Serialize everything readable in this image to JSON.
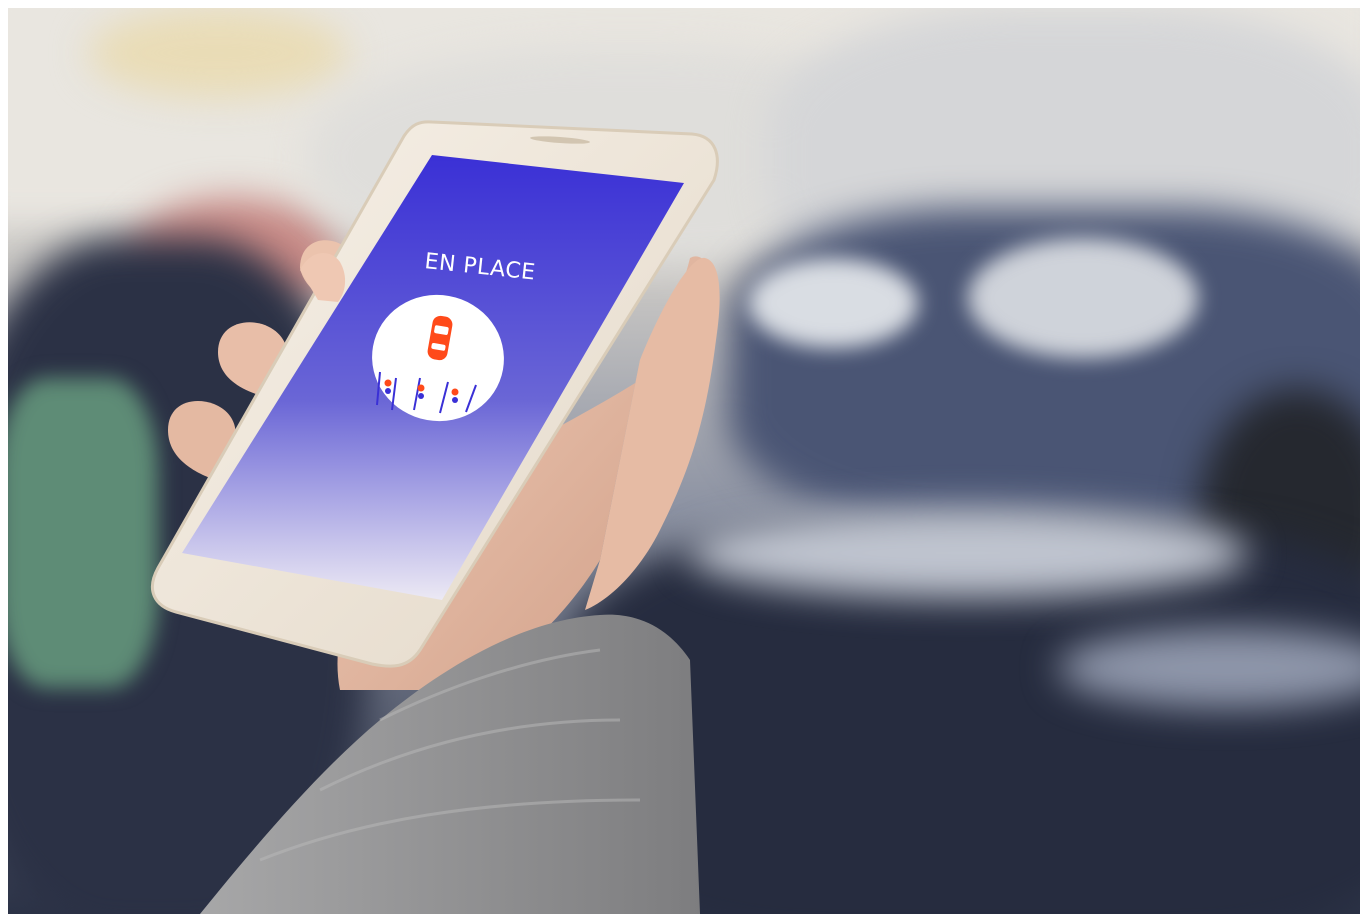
{
  "app": {
    "title": "EN PLACE",
    "screen_gradient_top": "#3a30d6",
    "screen_gradient_bottom": "#f0edf4",
    "car_color": "#ff4a1a"
  },
  "scene": {
    "phone_color": "#efe7dc",
    "sleeve_color": "#9a9a9a",
    "skin_color": "#e2b9a4"
  },
  "icons": {
    "logo": "car-parking-icon"
  }
}
